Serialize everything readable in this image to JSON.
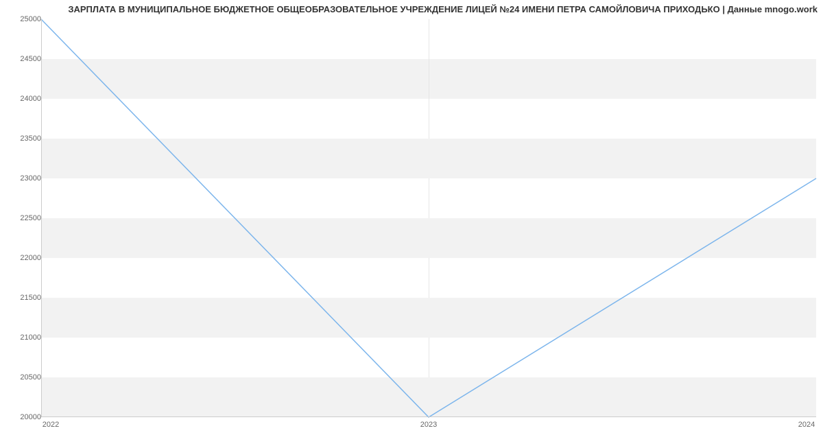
{
  "chart_data": {
    "type": "line",
    "title": "ЗАРПЛАТА В МУНИЦИПАЛЬНОЕ БЮДЖЕТНОЕ ОБЩЕОБРАЗОВАТЕЛЬНОЕ УЧРЕЖДЕНИЕ ЛИЦЕЙ №24  ИМЕНИ ПЕТРА САМОЙЛОВИЧА ПРИХОДЬКО | Данные mnogo.work",
    "x": [
      2022,
      2023,
      2024
    ],
    "values": [
      25000,
      20000,
      23000
    ],
    "x_ticks": [
      "2022",
      "2023",
      "2024"
    ],
    "y_ticks": [
      20000,
      20500,
      21000,
      21500,
      22000,
      22500,
      23000,
      23500,
      24000,
      24500,
      25000
    ],
    "xlim": [
      2022,
      2024
    ],
    "ylim": [
      20000,
      25000
    ],
    "colors": {
      "line": "#7cb5ec",
      "band": "#f2f2f2"
    },
    "xlabel": "",
    "ylabel": ""
  }
}
